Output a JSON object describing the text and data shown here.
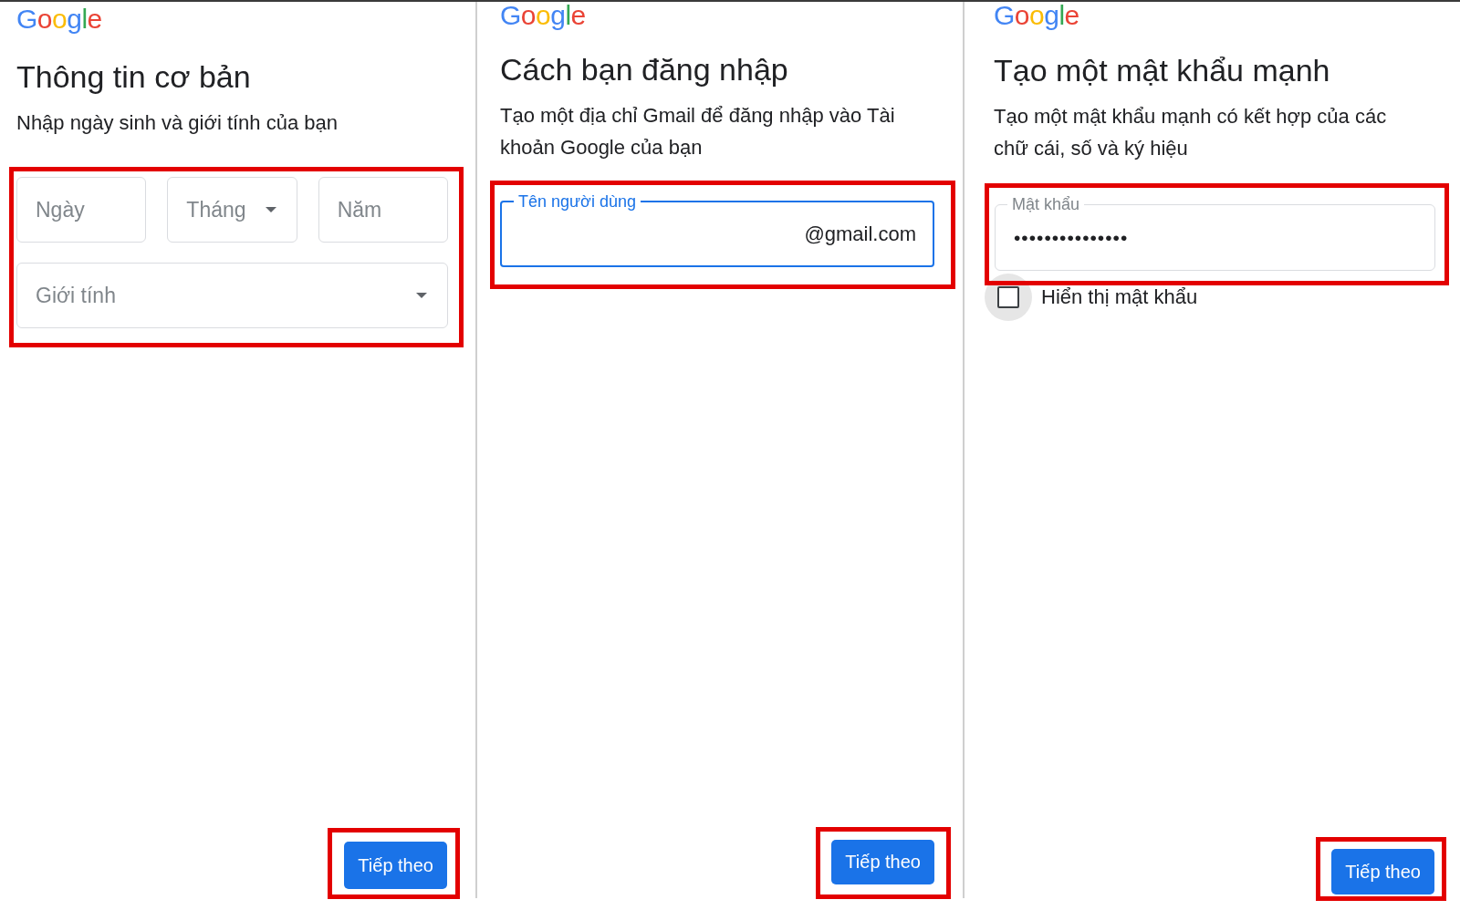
{
  "steps": [
    {
      "logo": "Google",
      "title": "Thông tin cơ bản",
      "subtitle": "Nhập ngày sinh và giới tính của bạn",
      "form": {
        "highlighted": true,
        "rows": [
          [
            {
              "kind": "text",
              "placeholder": "Ngày"
            },
            {
              "kind": "dropdown",
              "placeholder": "Tháng"
            },
            {
              "kind": "text",
              "placeholder": "Năm"
            }
          ],
          [
            {
              "kind": "dropdown",
              "placeholder": "Giới tính"
            }
          ]
        ]
      },
      "button": {
        "label": "Tiếp theo",
        "highlighted": true
      }
    },
    {
      "logo": "Google",
      "title": "Cách bạn đăng nhập",
      "subtitle": "Tạo một địa chỉ Gmail để đăng nhập vào Tài khoản Google của bạn",
      "form": {
        "highlighted": true,
        "rows": [
          [
            {
              "kind": "outlined",
              "label": "Tên người dùng",
              "suffix": "@gmail.com",
              "focused": true
            }
          ]
        ]
      },
      "button": {
        "label": "Tiếp theo",
        "highlighted": true
      }
    },
    {
      "logo": "Google",
      "title": "Tạo một mật khẩu mạnh",
      "subtitle": "Tạo một mật khẩu mạnh có kết hợp của các chữ cái, số và ký hiệu",
      "form": {
        "highlighted": true,
        "rows": [
          [
            {
              "kind": "outlined",
              "label": "Mật khẩu",
              "value": "•••••••••••••••",
              "focused": false
            }
          ]
        ]
      },
      "checkbox": {
        "label": "Hiển thị mật khẩu",
        "checked": false,
        "focused": true
      },
      "button": {
        "label": "Tiếp theo",
        "highlighted": true
      }
    }
  ]
}
